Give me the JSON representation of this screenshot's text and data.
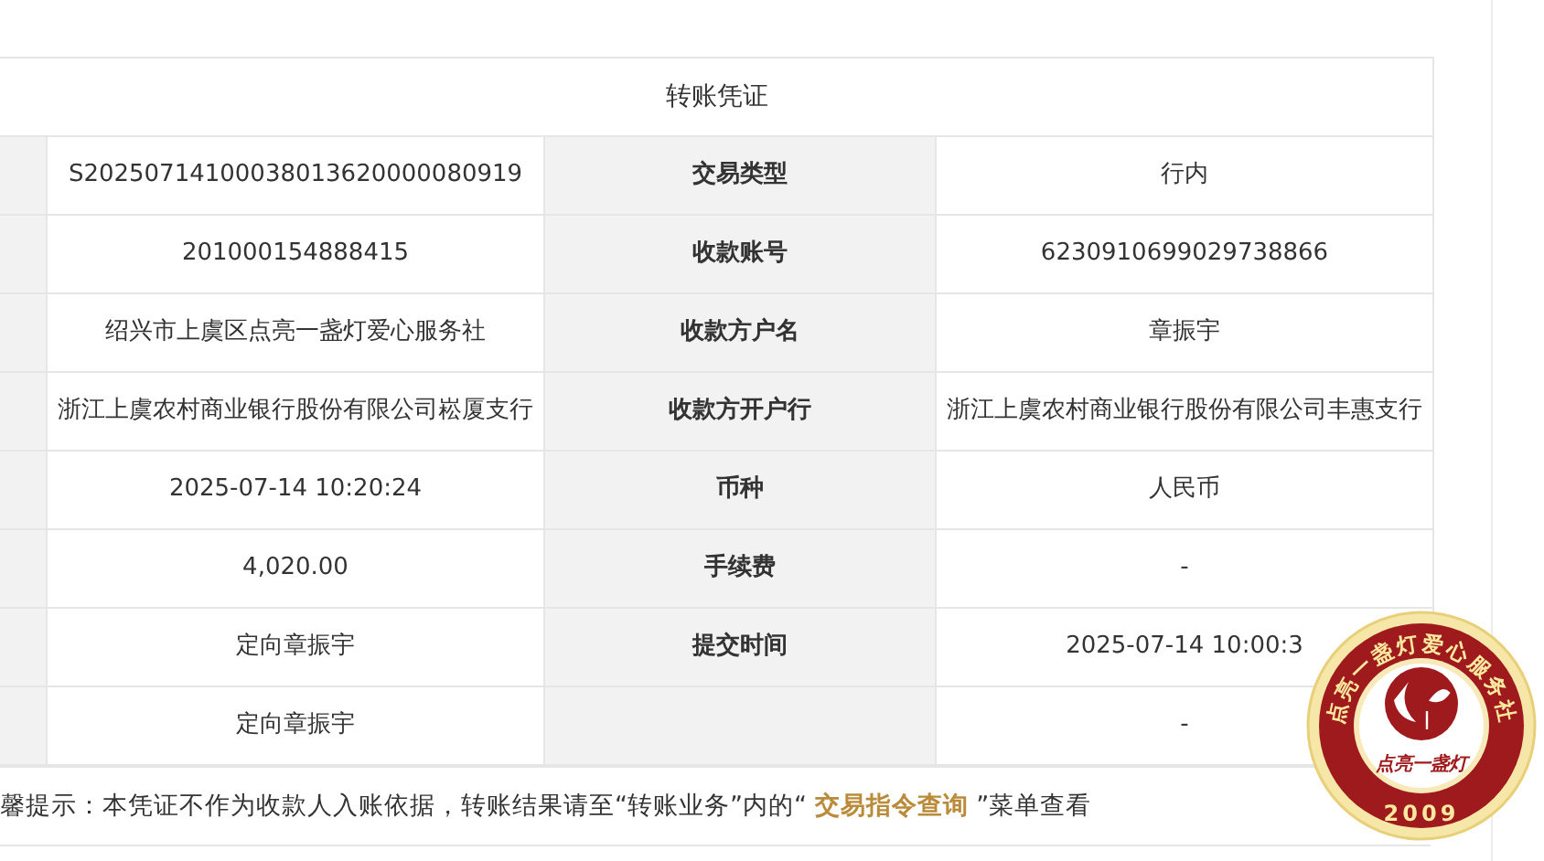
{
  "title": "转账凭证",
  "rows": [
    {
      "value": "S20250714100038013620000080919",
      "label": "交易类型",
      "value_2": "行内"
    },
    {
      "value": "201000154888415",
      "label": "收款账号",
      "value_2": "6230910699029738866"
    },
    {
      "value": "绍兴市上虞区点亮一盏灯爱心服务社",
      "label": "收款方户名",
      "value_2": "章振宇"
    },
    {
      "value": "浙江上虞农村商业银行股份有限公司崧厦支行",
      "label": "收款方开户行",
      "value_2": "浙江上虞农村商业银行股份有限公司丰惠支行"
    },
    {
      "value": "2025-07-14 10:20:24",
      "label": "币种",
      "value_2": "人民币"
    },
    {
      "value": "4,020.00",
      "label": "手续费",
      "value_2": "-"
    },
    {
      "value": "定向章振宇",
      "label": "提交时间",
      "value_2": "2025-07-14 10:00:3"
    },
    {
      "value": "定向章振宇",
      "value_2": "-"
    }
  ],
  "notice": {
    "text_before": "馨提示：本凭证不作为收款人入账依据，转账结果请至“转账业务”内的“ ",
    "link": "交易指令查询",
    "text_after": " ”菜单查看"
  },
  "seal": {
    "ring_text": "点亮一盏灯爱心服务社",
    "motto": "点亮一盏灯",
    "year": "2009"
  }
}
